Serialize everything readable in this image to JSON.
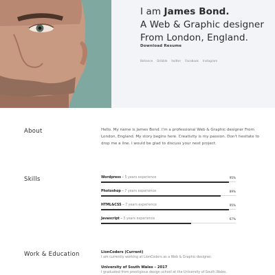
{
  "hero": {
    "line1_prefix": "I am ",
    "name": "James Bond.",
    "line2": "A Web & Graphic designer",
    "line3": "From London, England.",
    "download_label": "Download Resume",
    "social": [
      "Behance",
      "Dribble",
      "twitter",
      "Facebook",
      "Instagram"
    ],
    "colors": {
      "accent_panel": "#7fa9a0",
      "hero_bg": "#f3f4f8"
    }
  },
  "about": {
    "title": "About",
    "text": "Hello. My name is James Bond. I'm a professional Web & Graphic designer From London, England. My story begins here. Creativity is my passion. Don't hesitate to drop me a line. I would be glad to discuss your next project."
  },
  "skills": {
    "title": "Skills",
    "items": [
      {
        "name": "Wordpress",
        "experience": "5 years experience",
        "percent_label": "95%",
        "level": 0.95
      },
      {
        "name": "Photoshop",
        "experience": "7 years experience",
        "percent_label": "89%",
        "level": 0.89
      },
      {
        "name": "HTML&CSS",
        "experience": "7 years experience",
        "percent_label": "95%",
        "level": 0.95
      },
      {
        "name": "Javascript",
        "experience": "3 years experience",
        "percent_label": "67%",
        "level": 0.67
      }
    ]
  },
  "work": {
    "title": "Work & Education",
    "items": [
      {
        "title": "LionCoders (Current)",
        "desc": "I am currently working at LionCoders as a Web & Graphic designer."
      },
      {
        "title": "University of South Wales – 2017",
        "desc": "I graduated from prestigious design school at the University of South Wales."
      }
    ]
  }
}
